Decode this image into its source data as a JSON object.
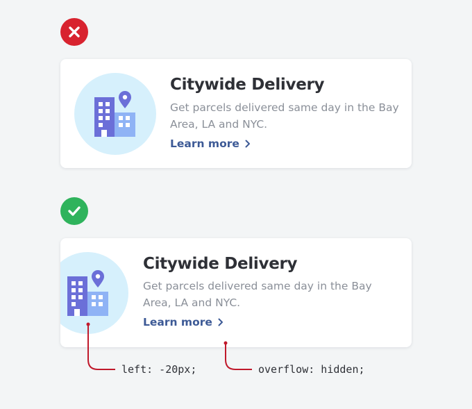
{
  "bad_example": {
    "badge": "close-icon",
    "card": {
      "title": "Citywide Delivery",
      "description": "Get parcels delivered same day in the Bay Area, LA and NYC.",
      "link": "Learn more",
      "icon": "city-building-icon"
    }
  },
  "good_example": {
    "badge": "check-icon",
    "card": {
      "title": "Citywide Delivery",
      "description": "Get parcels delivered same day in the Bay Area, LA and NYC.",
      "link": "Learn more",
      "icon": "city-building-icon"
    },
    "annotations": {
      "left_label": "left: -20px;",
      "overflow_label": "overflow: hidden;"
    }
  },
  "colors": {
    "background": "#f3f5f6",
    "error": "#d8232f",
    "success": "#2fb35c",
    "blob": "#d6f0fc",
    "building_dark": "#6b6fd8",
    "building_light": "#8fb3f5",
    "link": "#3d5a96",
    "annotation_line": "#c0192b"
  }
}
